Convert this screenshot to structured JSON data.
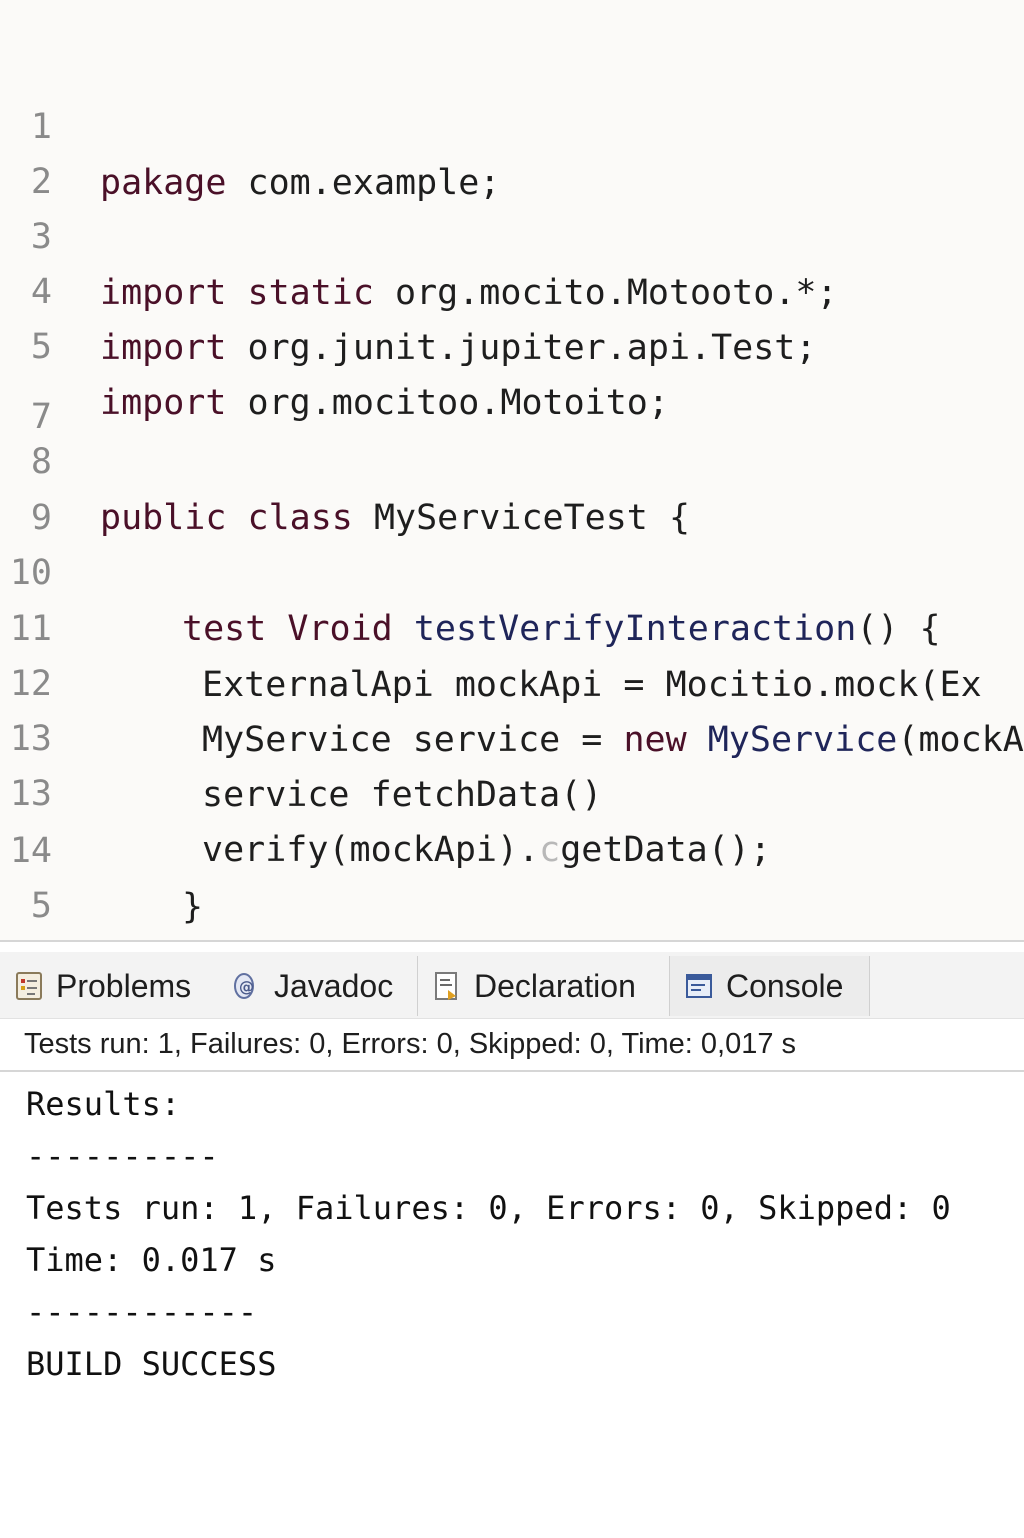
{
  "editor": {
    "lines": [
      {
        "num": "1",
        "tokens": [
          {
            "t": "pakage",
            "c": "kw"
          },
          {
            "t": " com.example;"
          }
        ]
      },
      {
        "num": "2",
        "tokens": []
      },
      {
        "num": "3",
        "tokens": [
          {
            "t": "import",
            "c": "kw"
          },
          {
            "t": " "
          },
          {
            "t": "static",
            "c": "kw"
          },
          {
            "t": " org.mocito.Motooto.*;"
          }
        ]
      },
      {
        "num": "4",
        "tokens": [
          {
            "t": "import",
            "c": "kw"
          },
          {
            "t": " org.junit.jupiter.api.Test;"
          }
        ]
      },
      {
        "num": "5",
        "tokens": [
          {
            "t": "import",
            "c": "kw"
          },
          {
            "t": " org.mocitoo.Motoito;"
          }
        ]
      },
      {
        "num": "7",
        "tokens": []
      },
      {
        "num": "8",
        "tokens": [
          {
            "t": "public",
            "c": "kw"
          },
          {
            "t": " "
          },
          {
            "t": "class",
            "c": "kw"
          },
          {
            "t": " MyServiceTest {"
          }
        ]
      },
      {
        "num": "9",
        "tokens": []
      },
      {
        "num": "10",
        "tokens": [
          {
            "t": "test",
            "c": "kw"
          },
          {
            "t": " "
          },
          {
            "t": "Vroid",
            "c": "kw"
          },
          {
            "t": " "
          },
          {
            "t": "testVerifyInteraction",
            "c": "mt"
          },
          {
            "t": "() {"
          }
        ]
      },
      {
        "num": "11",
        "tokens": [
          {
            "t": "ExternalApi mockApi = Mocitio.mock(Ex"
          }
        ]
      },
      {
        "num": "12",
        "tokens": [
          {
            "t": "MyService service = "
          },
          {
            "t": "new",
            "c": "kw"
          },
          {
            "t": " "
          },
          {
            "t": "MyService",
            "c": "mt"
          },
          {
            "t": "(mockAp"
          }
        ]
      },
      {
        "num": "13",
        "tokens": [
          {
            "t": "service fetchData()"
          }
        ]
      },
      {
        "num": "13",
        "tokens": [
          {
            "t": "verify(mockApi)."
          },
          {
            "t": "c",
            "c": "cur"
          },
          {
            "t": "getData();"
          }
        ]
      },
      {
        "num": "14",
        "tokens": [
          {
            "t": "}"
          }
        ]
      },
      {
        "num": "5",
        "tokens": [
          {
            "t": "}"
          }
        ]
      }
    ]
  },
  "tabs": [
    {
      "label": "Problems",
      "icon": "problems-icon"
    },
    {
      "label": "Javadoc",
      "icon": "javadoc-icon"
    },
    {
      "label": "Declaration",
      "icon": "declaration-icon"
    },
    {
      "label": "Console",
      "icon": "console-icon"
    }
  ],
  "status_line": "Tests run: 1, Failures: 0, Errors: 0, Skipped: 0, Time: 0,017 s",
  "console": {
    "lines": [
      "Results:",
      "----------",
      "Tests run: 1, Failures: 0, Errors: 0, Skipped: 0",
      "Time: 0.017 s",
      "------------",
      "BUILD SUCCESS"
    ]
  }
}
